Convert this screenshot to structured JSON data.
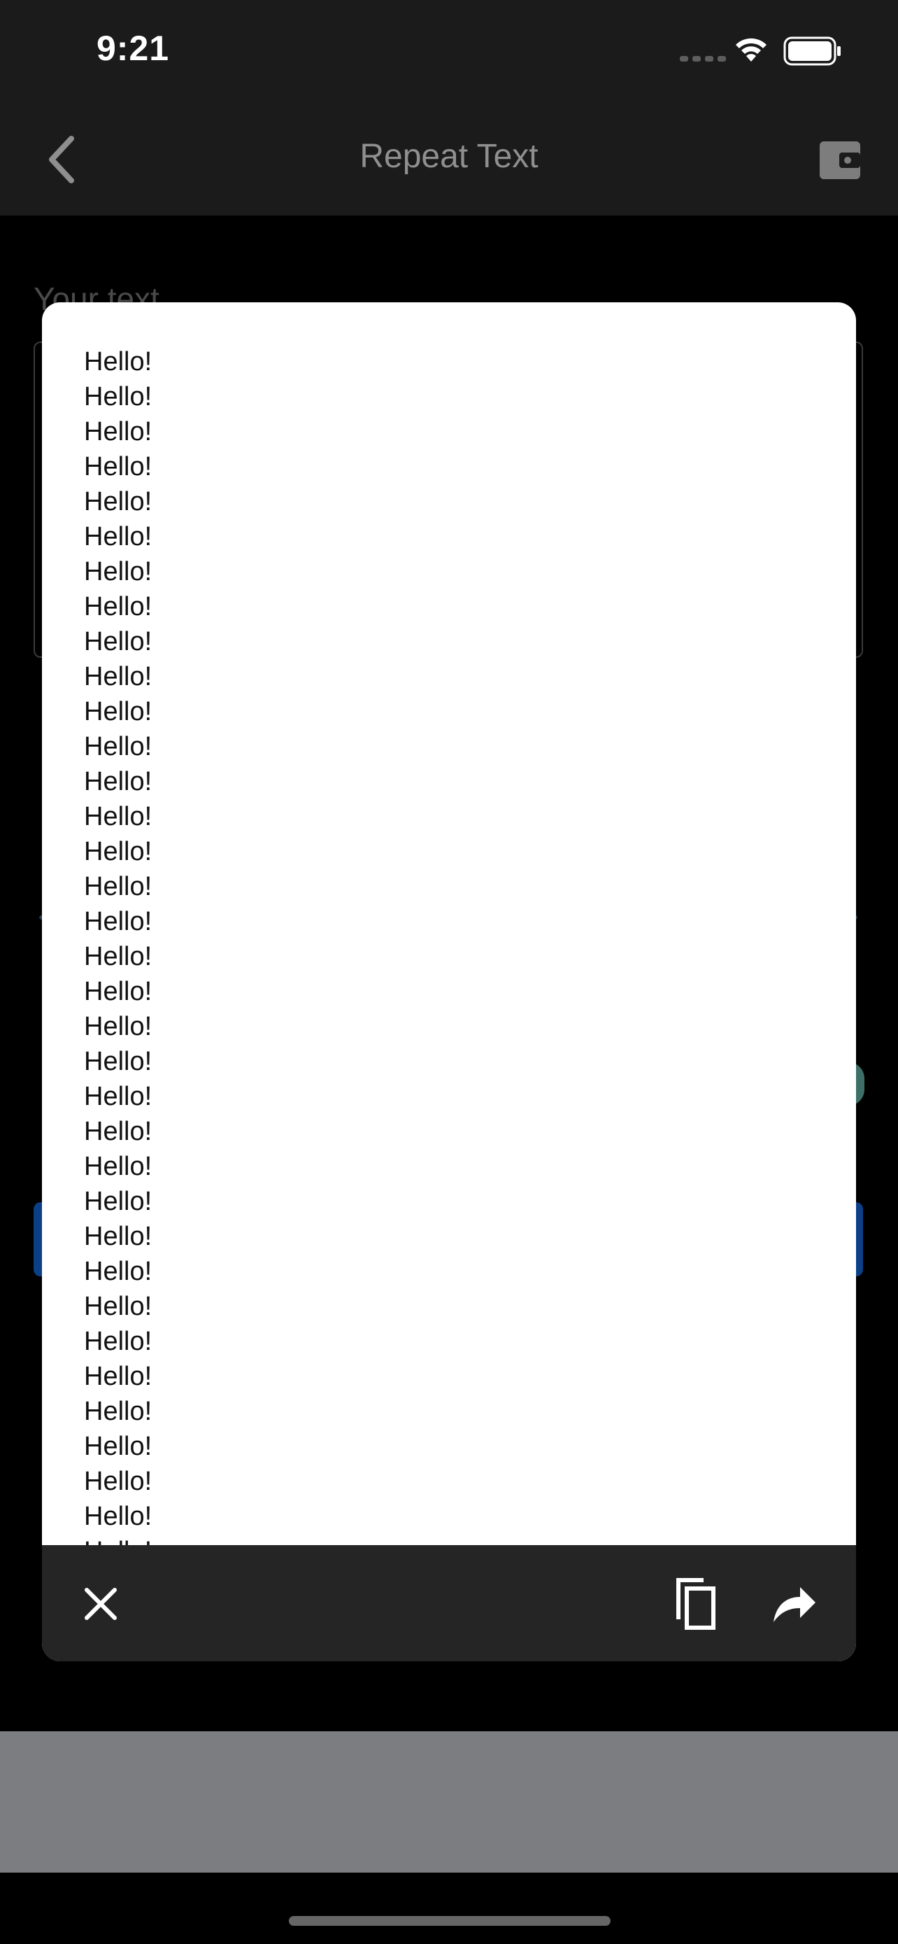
{
  "status_bar": {
    "time": "9:21"
  },
  "nav": {
    "title": "Repeat Text"
  },
  "background": {
    "input_label": "Your text"
  },
  "modal": {
    "lines": [
      "Hello!",
      "Hello!",
      "Hello!",
      "Hello!",
      "Hello!",
      "Hello!",
      "Hello!",
      "Hello!",
      "Hello!",
      "Hello!",
      "Hello!",
      "Hello!",
      "Hello!",
      "Hello!",
      "Hello!",
      "Hello!",
      "Hello!",
      "Hello!",
      "Hello!",
      "Hello!",
      "Hello!",
      "Hello!",
      "Hello!",
      "Hello!",
      "Hello!",
      "Hello!",
      "Hello!",
      "Hello!",
      "Hello!",
      "Hello!",
      "Hello!",
      "Hello!",
      "Hello!",
      "Hello!",
      "Hello!"
    ],
    "footer_icons": [
      "close-icon",
      "copy-icon",
      "share-icon"
    ]
  }
}
